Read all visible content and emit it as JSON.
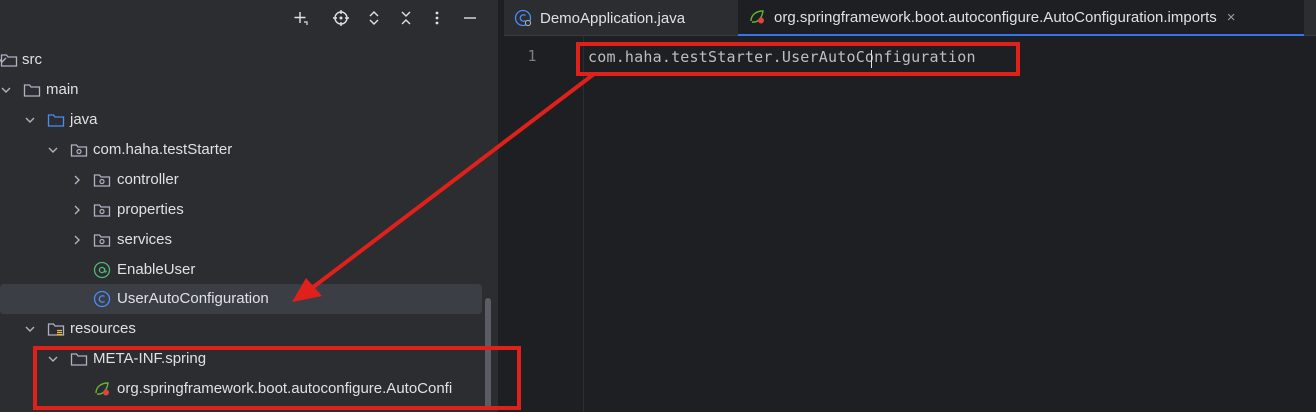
{
  "colors": {
    "panel_bg": "#2b2d30",
    "editor_bg": "#1e1f22",
    "selection": "#3b3e44",
    "folder": "#aeb3c2",
    "source_folder": "#4a8df8",
    "class_icon": "#4a8df8",
    "annotation_icon": "#4fb87a",
    "annotation_red": "#e0201b",
    "tab_accent": "#3574f0"
  },
  "project_panel": {
    "toolbar_icons": [
      "add-icon",
      "locate-icon",
      "expand-all-icon",
      "collapse-all-icon",
      "more-icon",
      "hide-icon"
    ],
    "tree": [
      {
        "label": "src",
        "icon": "folder-icon",
        "expanded": true
      },
      {
        "label": "main",
        "icon": "folder-icon",
        "expanded": true
      },
      {
        "label": "java",
        "icon": "source-folder-icon",
        "expanded": true
      },
      {
        "label": "com.haha.testStarter",
        "icon": "package-icon",
        "expanded": true
      },
      {
        "label": "controller",
        "icon": "package-icon",
        "expanded": false
      },
      {
        "label": "properties",
        "icon": "package-icon",
        "expanded": false
      },
      {
        "label": "services",
        "icon": "package-icon",
        "expanded": false
      },
      {
        "label": "EnableUser",
        "icon": "annotation-icon"
      },
      {
        "label": "UserAutoConfiguration",
        "icon": "class-icon",
        "selected": true
      },
      {
        "label": "resources",
        "icon": "resources-folder-icon",
        "expanded": true
      },
      {
        "label": "META-INF.spring",
        "icon": "folder-icon",
        "expanded": true
      },
      {
        "label": "org.springframework.boot.autoconfigure.AutoConfi",
        "icon": "spring-file-icon"
      }
    ]
  },
  "editor": {
    "tabs": [
      {
        "label": "DemoApplication.java",
        "icon": "java-class-icon",
        "active": false
      },
      {
        "label": "org.springframework.boot.autoconfigure.AutoConfiguration.imports",
        "icon": "spring-file-icon",
        "active": true,
        "close": "×"
      }
    ],
    "lines": [
      {
        "number": "1",
        "text": "com.haha.testStarter.UserAutoConfiguration"
      }
    ]
  }
}
